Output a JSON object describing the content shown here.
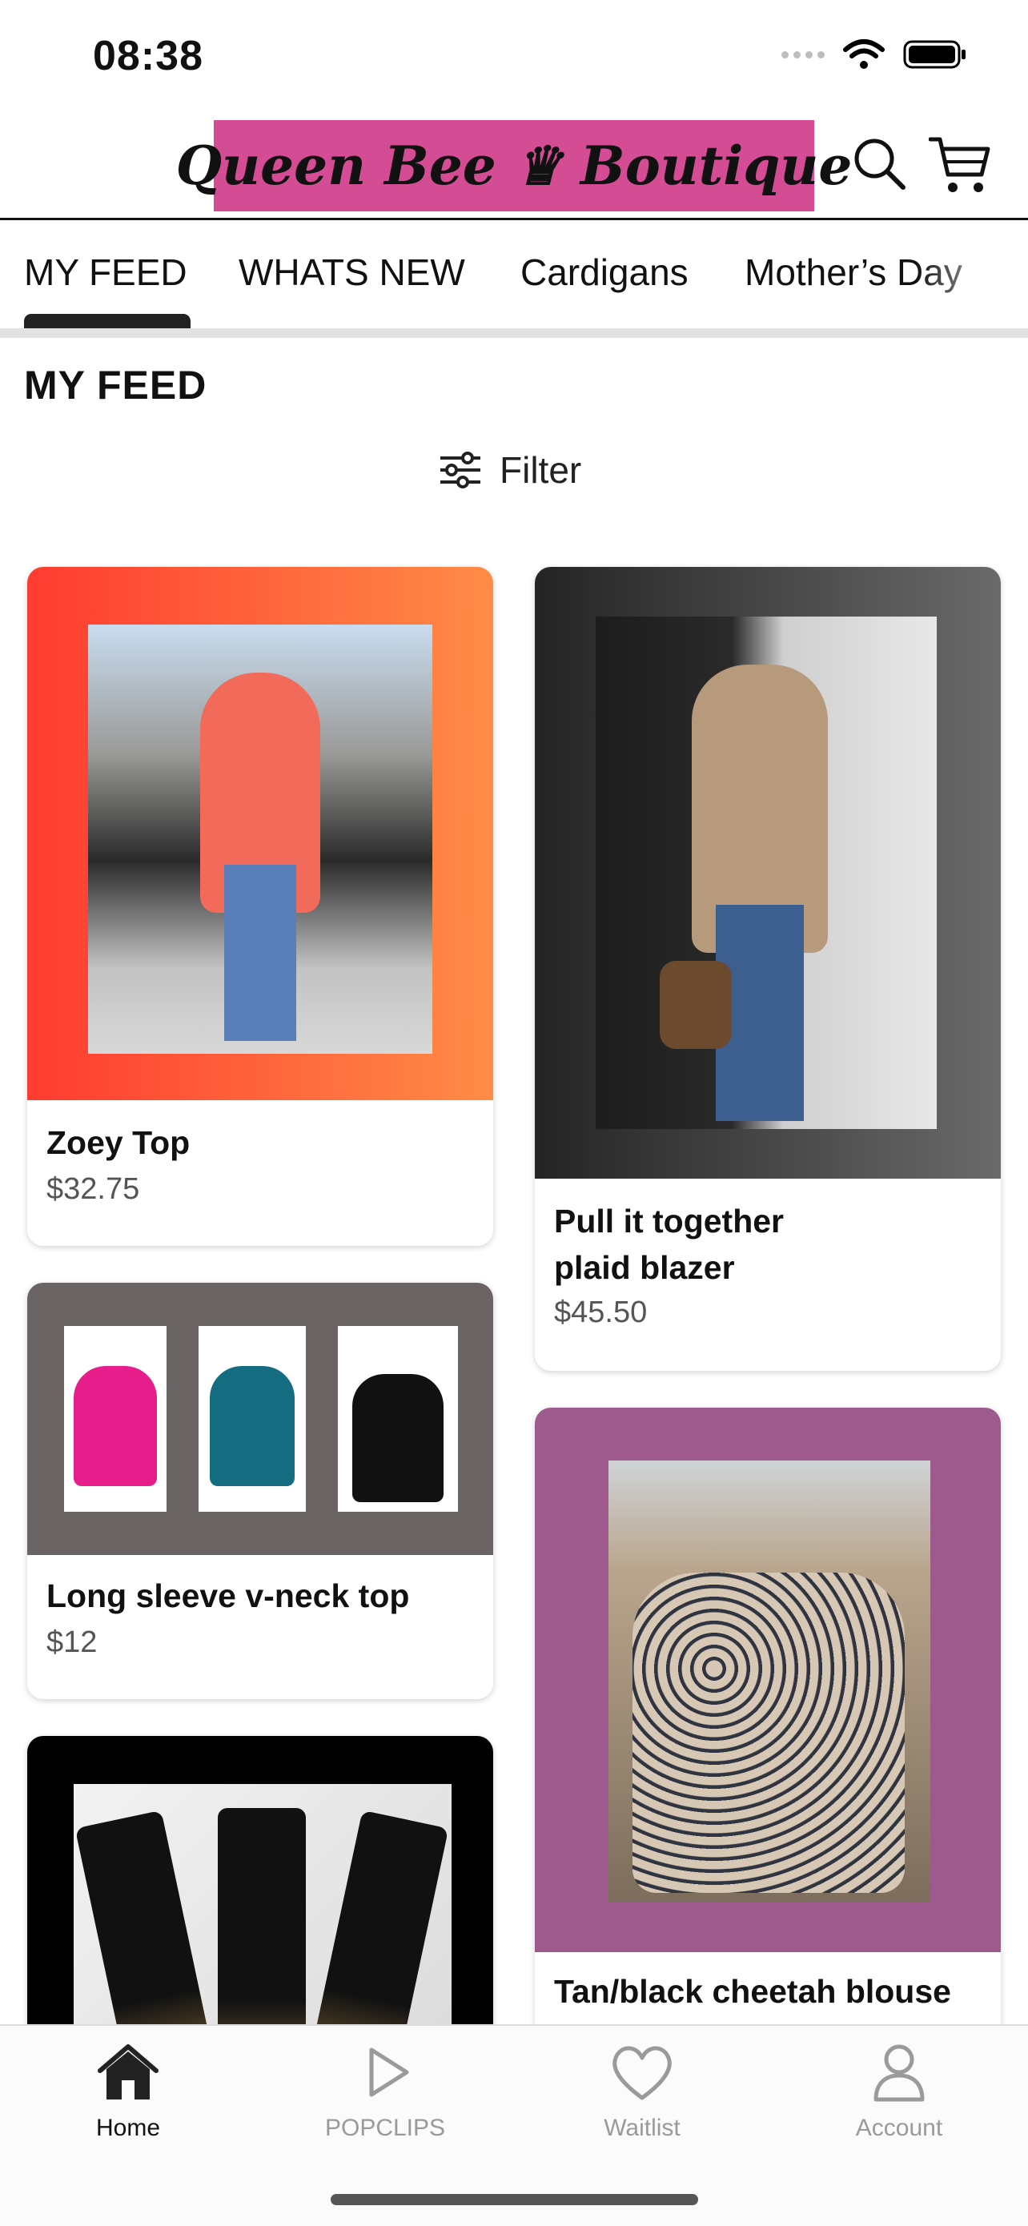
{
  "status_bar": {
    "time": "08:38"
  },
  "header": {
    "logo_text": "Queen Bee ♛ Boutique",
    "logo_color": "#d44c93"
  },
  "tabs": [
    {
      "label": "MY FEED"
    },
    {
      "label": "WHATS NEW"
    },
    {
      "label": "Cardigans"
    },
    {
      "label": "Mother’s Day"
    }
  ],
  "feed": {
    "title": "MY FEED",
    "filter_label": "Filter"
  },
  "products": [
    {
      "name": "Zoey Top",
      "price": "$32.75",
      "bg_color": "#ff6a3a"
    },
    {
      "name": "Pull it together plaid blazer",
      "price": "$45.50",
      "bg_color": "#3a3a3a"
    },
    {
      "name": "Long sleeve v-neck top",
      "price": "$12",
      "bg_color": "#6a6564"
    },
    {
      "name": "Tan/black cheetah blouse",
      "price": "",
      "bg_color": "#9e5a8d"
    },
    {
      "name": "",
      "price": "",
      "bg_color": "#000000"
    }
  ],
  "bottom_nav": [
    {
      "label": "Home",
      "icon": "home-icon",
      "active": true
    },
    {
      "label": "POPCLIPS",
      "icon": "play-icon",
      "active": false
    },
    {
      "label": "Waitlist",
      "icon": "heart-icon",
      "active": false
    },
    {
      "label": "Account",
      "icon": "person-icon",
      "active": false
    }
  ]
}
